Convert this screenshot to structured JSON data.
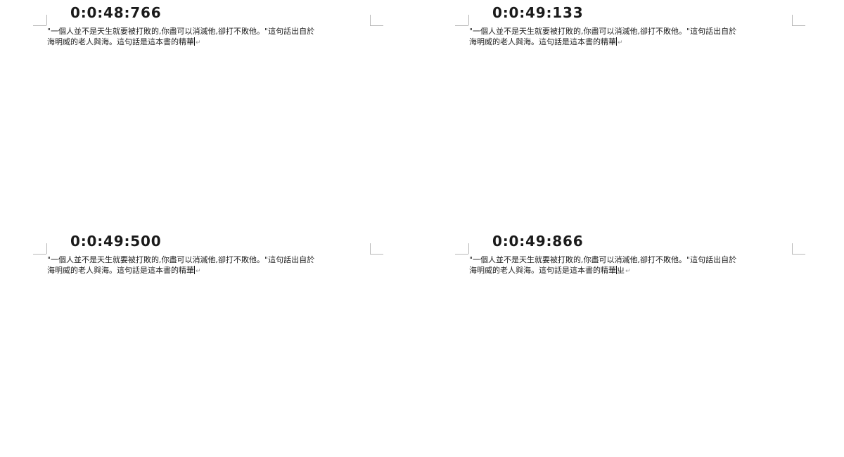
{
  "frames": [
    {
      "timestamp": "0:0:48:766",
      "line1": "\"一個人並不是天生就要被打敗的,你盡可以消滅他,卻打不敗他。\"這句話出自於",
      "line2": "海明威的老人與海。這句話是這本書的精華",
      "extra": "",
      "para_mark": "↵"
    },
    {
      "timestamp": "0:0:49:133",
      "line1": "\"一個人並不是天生就要被打敗的,你盡可以消滅他,卻打不敗他。\"這句話出自於",
      "line2": "海明威的老人與海。這句話是這本書的精華",
      "extra": "",
      "para_mark": "↵"
    },
    {
      "timestamp": "0:0:49:500",
      "line1": "\"一個人並不是天生就要被打敗的,你盡可以消滅他,卻打不敗他。\"這句話出自於",
      "line2": "海明威的老人與海。這句話是這本書的精華",
      "extra": "",
      "para_mark": "↵"
    },
    {
      "timestamp": "0:0:49:866",
      "line1": "\"一個人並不是天生就要被打敗的,你盡可以消滅他,卻打不敗他。\"這句話出自於",
      "line2": "海明威的老人與海。這句話是這本書的精華",
      "extra": "ㄓ",
      "para_mark": "↵"
    }
  ]
}
